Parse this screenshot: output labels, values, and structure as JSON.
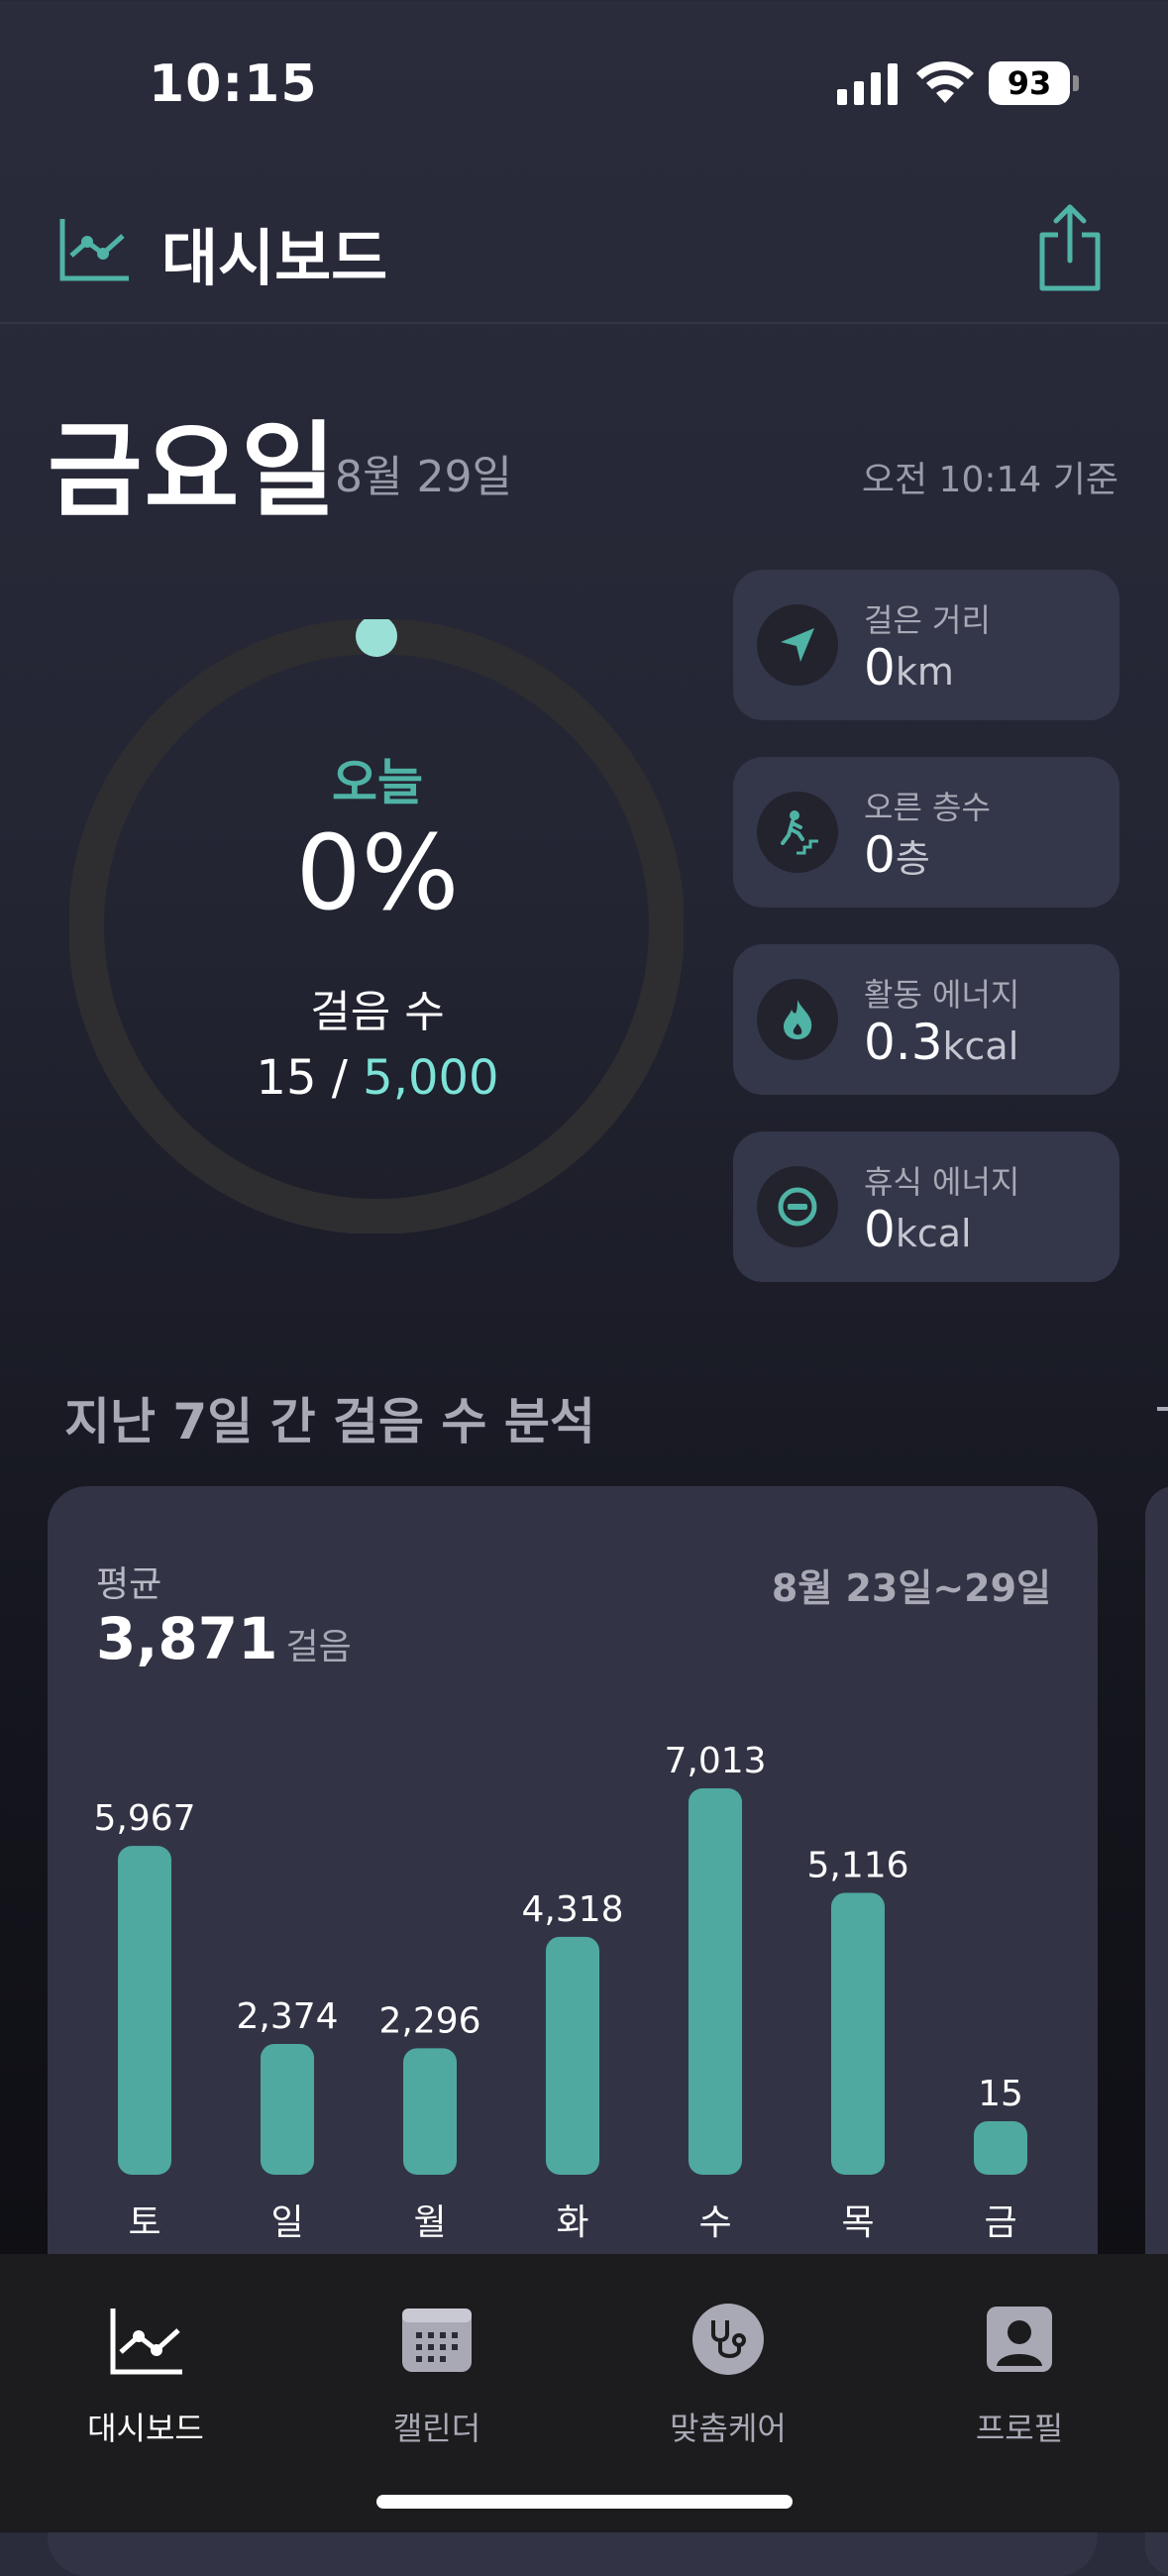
{
  "status_bar": {
    "time": "10:15",
    "battery": "93"
  },
  "header": {
    "title": "대시보드"
  },
  "date_row": {
    "day": "금요일",
    "date": "8월 29일",
    "as_of": "오전 10:14 기준"
  },
  "ring": {
    "today_label": "오늘",
    "percent": "0%",
    "steps_label": "걸음 수",
    "steps_current": "15",
    "steps_separator": " / ",
    "steps_goal": "5,000",
    "progress": 0.0
  },
  "stats": [
    {
      "label": "걸은 거리",
      "value": "0",
      "unit": "km",
      "icon": "location-arrow-icon"
    },
    {
      "label": "오른 층수",
      "value": "0",
      "unit": "층",
      "icon": "stairs-icon"
    },
    {
      "label": "활동 에너지",
      "value": "0.3",
      "unit": "kcal",
      "icon": "flame-icon"
    },
    {
      "label": "휴식 에너지",
      "value": "0",
      "unit": "kcal",
      "icon": "rest-icon"
    }
  ],
  "section": {
    "title": "지난 7일 간 걸음 수 분석"
  },
  "weekly": {
    "avg_label": "평균",
    "avg_value": "3,871",
    "avg_unit": "걸음",
    "range": "8월 23일~29일"
  },
  "chart_data": {
    "type": "bar",
    "categories": [
      "토",
      "일",
      "월",
      "화",
      "수",
      "목",
      "금"
    ],
    "values": [
      5967,
      2374,
      2296,
      4318,
      7013,
      5116,
      15
    ],
    "value_labels": [
      "5,967",
      "2,374",
      "2,296",
      "4,318",
      "7,013",
      "5,116",
      "15"
    ],
    "color": "#4fa9a0"
  },
  "tabs": [
    {
      "label": "대시보드",
      "icon": "chart-line-icon",
      "active": true
    },
    {
      "label": "캘린더",
      "icon": "calendar-icon",
      "active": false
    },
    {
      "label": "맞춤케어",
      "icon": "stethoscope-icon",
      "active": false
    },
    {
      "label": "프로필",
      "icon": "profile-icon",
      "active": false
    }
  ],
  "colors": {
    "accent": "#4fb3a5",
    "goal": "#7de3d8",
    "card": "#34364a",
    "bar": "#4fa9a0"
  }
}
